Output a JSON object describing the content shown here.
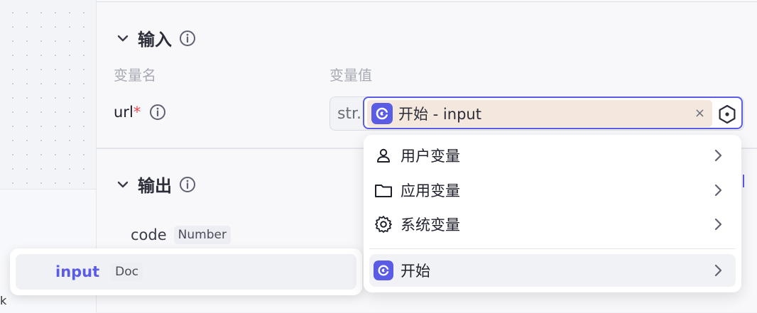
{
  "canvas": {
    "edge_text": "k"
  },
  "input_section": {
    "title": "输入",
    "col_name": "变量名",
    "col_value": "变量值",
    "param": {
      "name": "url",
      "required_mark": "*"
    },
    "value": {
      "type_tag": "str.",
      "variable_text": "开始 - input",
      "clear_symbol": "×"
    }
  },
  "output_section": {
    "title": "输出",
    "field": {
      "name": "code",
      "type": "Number"
    }
  },
  "floating_node": {
    "var_name": "input",
    "type": "Doc"
  },
  "menu": {
    "items": [
      {
        "label": "用户变量",
        "icon": "user-icon"
      },
      {
        "label": "应用变量",
        "icon": "folder-icon"
      },
      {
        "label": "系统变量",
        "icon": "gear-icon"
      }
    ],
    "node_item": {
      "label": "开始",
      "icon": "start-node-icon"
    }
  },
  "colors": {
    "accent": "#5b5ce6",
    "chip_bg": "#f3e7de",
    "required": "#e5484d"
  }
}
